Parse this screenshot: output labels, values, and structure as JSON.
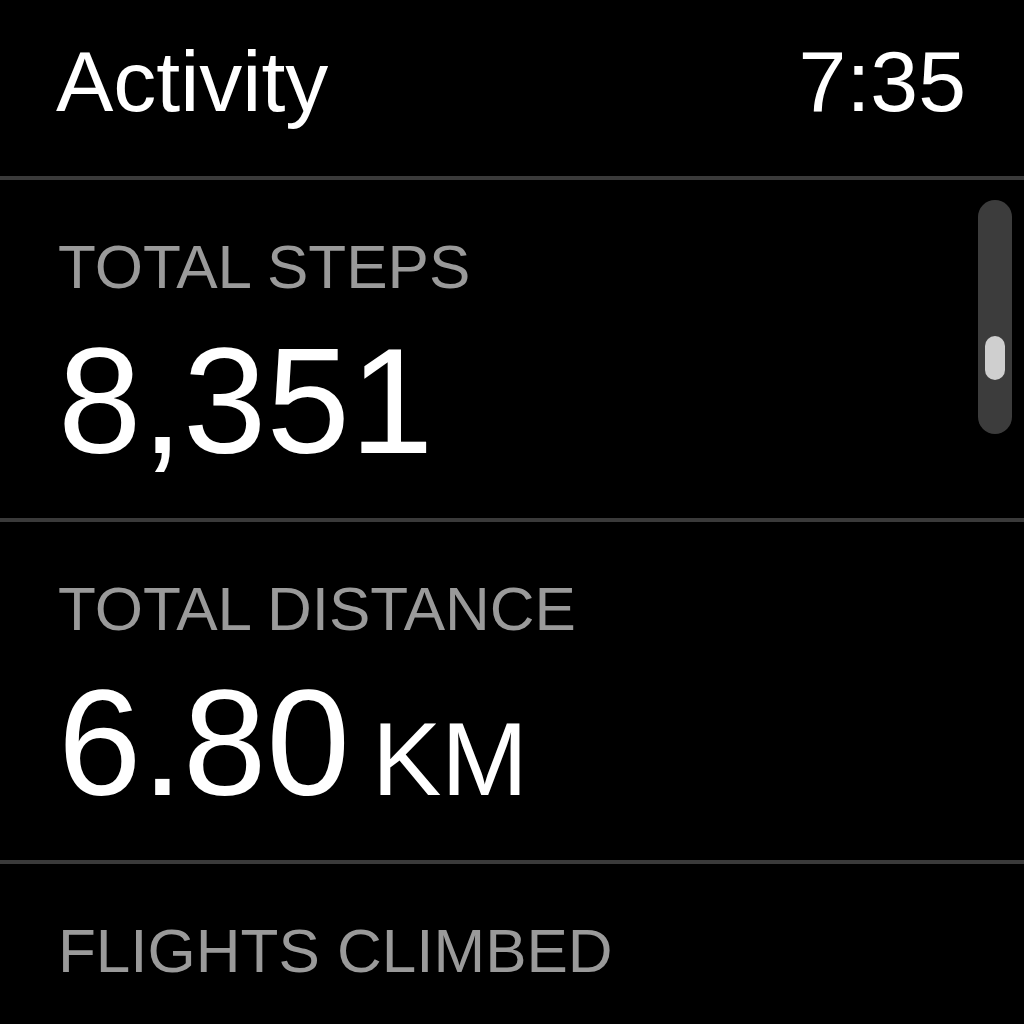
{
  "header": {
    "title": "Activity",
    "time": "7:35"
  },
  "metrics": [
    {
      "label": "TOTAL STEPS",
      "value": "8,351"
    },
    {
      "label": "TOTAL DISTANCE",
      "value": "6.80",
      "unit": "KM"
    },
    {
      "label": "FLIGHTS CLIMBED"
    }
  ]
}
